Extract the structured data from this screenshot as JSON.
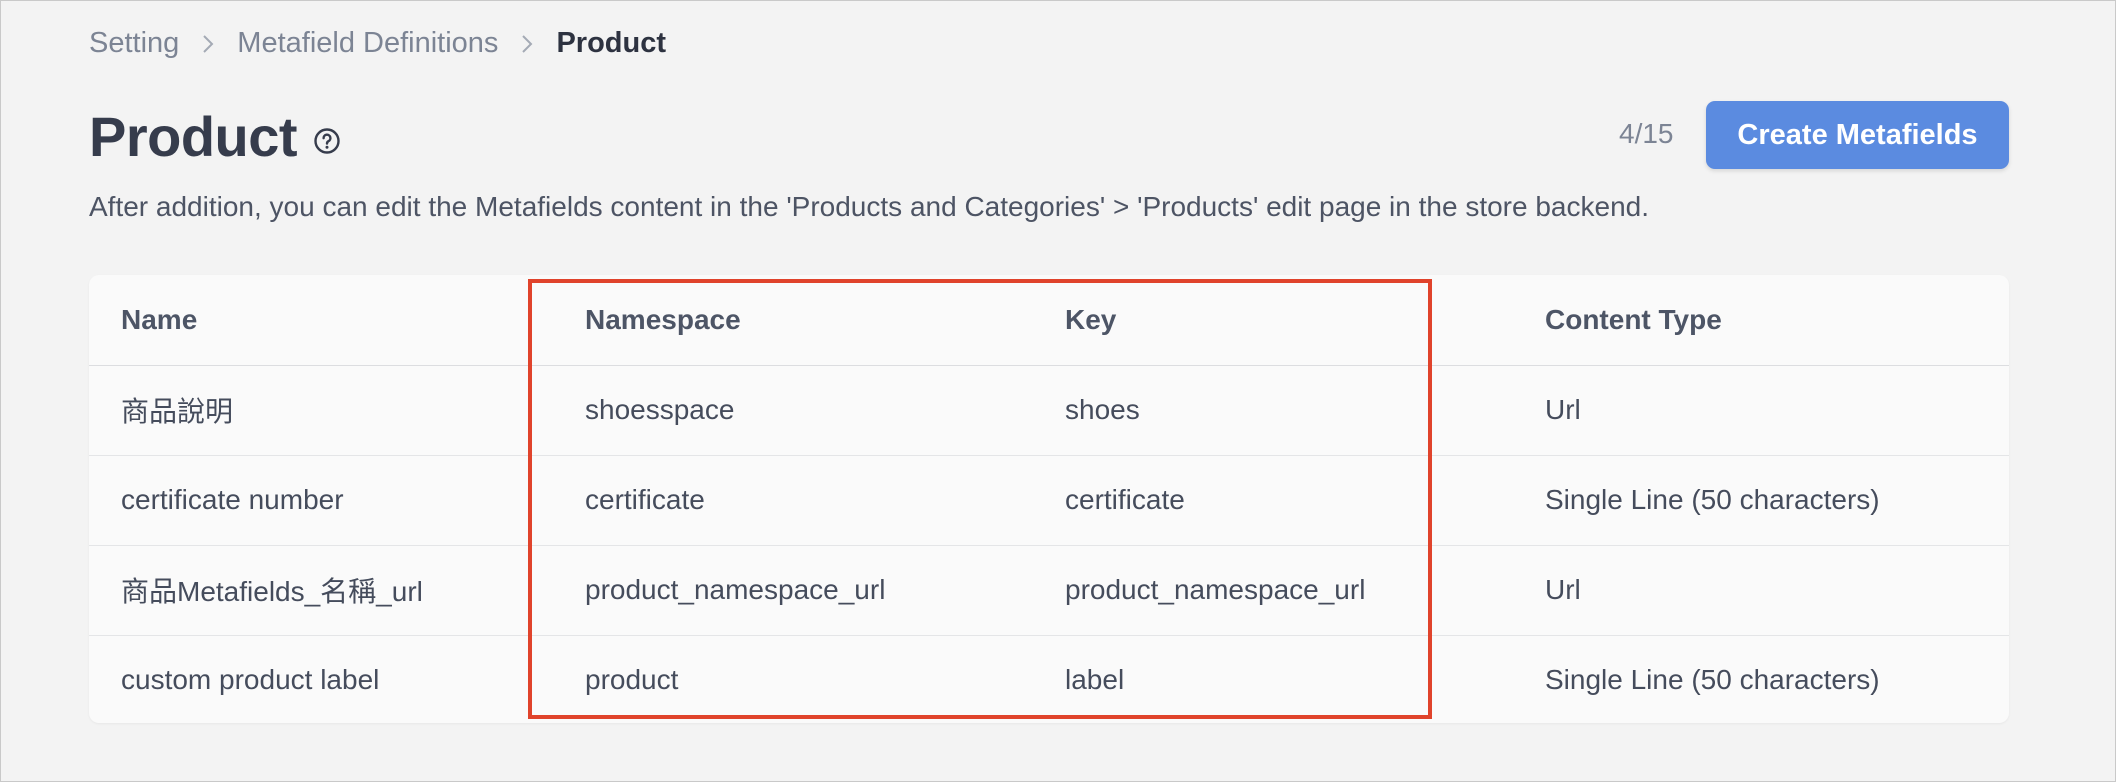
{
  "breadcrumb": {
    "items": [
      "Setting",
      "Metafield Definitions"
    ],
    "current": "Product"
  },
  "header": {
    "title": "Product",
    "count": "4/15",
    "create_button": "Create Metafields",
    "description": "After addition, you can edit the Metafields content in the 'Products and Categories' > 'Products' edit page in the store backend."
  },
  "table": {
    "columns": [
      "Name",
      "Namespace",
      "Key",
      "Content Type"
    ],
    "rows": [
      {
        "name": "商品說明",
        "namespace": "shoesspace",
        "key": "shoes",
        "content_type": "Url"
      },
      {
        "name": "certificate number",
        "namespace": "certificate",
        "key": "certificate",
        "content_type": "Single Line (50 characters)"
      },
      {
        "name": "商品Metafields_名稱_url",
        "namespace": "product_namespace_url",
        "key": "product_namespace_url",
        "content_type": "Url"
      },
      {
        "name": "custom product label",
        "namespace": "product",
        "key": "label",
        "content_type": "Single Line (50 characters)"
      }
    ]
  },
  "icons": {
    "breadcrumb_separator": "chevron-right-icon",
    "title_help": "question-circle-icon"
  },
  "colors": {
    "primary_button": "#5b8be0",
    "highlight_border": "#e0432b"
  }
}
